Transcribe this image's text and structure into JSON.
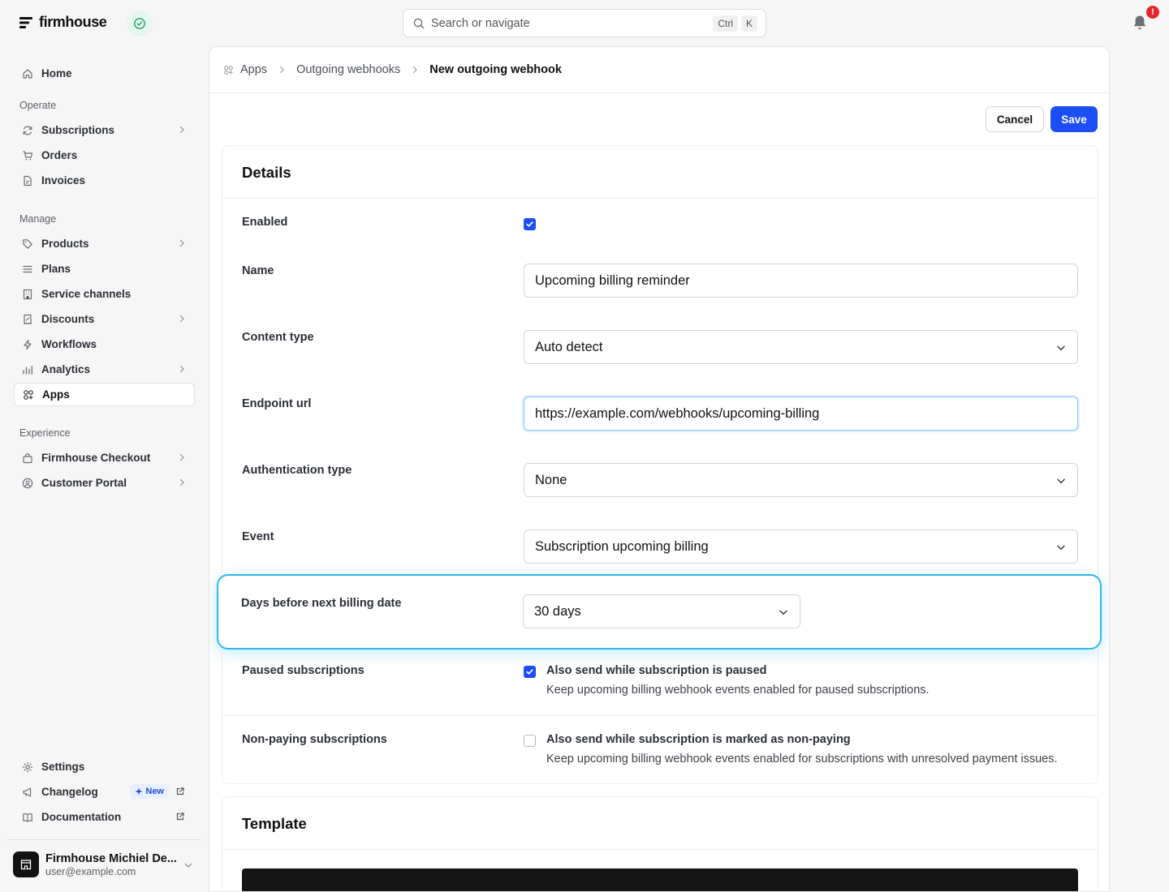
{
  "app": {
    "brand": "firmhouse"
  },
  "search": {
    "placeholder": "Search or navigate",
    "kbd_1": "Ctrl",
    "kbd_2": "K"
  },
  "notifications": {
    "badge": "!"
  },
  "sidebar": {
    "home": "Home",
    "section_operate": "Operate",
    "subscriptions": "Subscriptions",
    "orders": "Orders",
    "invoices": "Invoices",
    "section_manage": "Manage",
    "products": "Products",
    "plans": "Plans",
    "service_channels": "Service channels",
    "discounts": "Discounts",
    "workflows": "Workflows",
    "analytics": "Analytics",
    "apps": "Apps",
    "section_experience": "Experience",
    "firmhouse_checkout": "Firmhouse Checkout",
    "customer_portal": "Customer Portal",
    "settings": "Settings",
    "changelog": "Changelog",
    "changelog_badge": "New",
    "documentation": "Documentation"
  },
  "account": {
    "name": "Firmhouse Michiel De...",
    "email": "user@example.com"
  },
  "breadcrumb": {
    "apps": "Apps",
    "outgoing_webhooks": "Outgoing webhooks",
    "current": "New outgoing webhook"
  },
  "actions": {
    "cancel": "Cancel",
    "save": "Save"
  },
  "details": {
    "title": "Details",
    "enabled_label": "Enabled",
    "enabled": true,
    "name_label": "Name",
    "name_value": "Upcoming billing reminder",
    "content_type_label": "Content type",
    "content_type_value": "Auto detect",
    "endpoint_label": "Endpoint url",
    "endpoint_value": "https://example.com/webhooks/upcoming-billing",
    "auth_label": "Authentication type",
    "auth_value": "None",
    "event_label": "Event",
    "event_value": "Subscription upcoming billing",
    "days_label": "Days before next billing date",
    "days_value": "30 days",
    "paused_label": "Paused subscriptions",
    "paused_checked": true,
    "paused_title": "Also send while subscription is paused",
    "paused_desc": "Keep upcoming billing webhook events enabled for paused subscriptions.",
    "nonpaying_label": "Non-paying subscriptions",
    "nonpaying_checked": false,
    "nonpaying_title": "Also send while subscription is marked as non-paying",
    "nonpaying_desc": "Keep upcoming billing webhook events enabled for subscriptions with unresolved payment issues."
  },
  "template": {
    "title": "Template"
  },
  "colors": {
    "accent": "#1d4ef5",
    "highlight": "#2db8e8",
    "badge": "#e5262e"
  }
}
